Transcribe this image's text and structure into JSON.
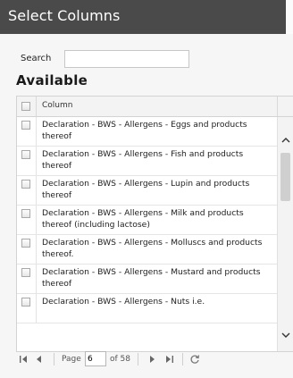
{
  "dialog": {
    "title": "Select Columns"
  },
  "search": {
    "label": "Search",
    "value": "",
    "placeholder": ""
  },
  "available": {
    "title": "Available",
    "column_header": "Column",
    "rows": [
      {
        "label": "Declaration - BWS - Allergens - Eggs and products thereof",
        "checked": false
      },
      {
        "label": "Declaration - BWS - Allergens - Fish and products thereof",
        "checked": false
      },
      {
        "label": "Declaration - BWS - Allergens - Lupin and products thereof",
        "checked": false
      },
      {
        "label": "Declaration - BWS - Allergens - Milk and products thereof (including lactose)",
        "checked": false
      },
      {
        "label": "Declaration - BWS - Allergens - Molluscs and products thereof.",
        "checked": false
      },
      {
        "label": "Declaration - BWS - Allergens - Mustard and products thereof",
        "checked": false
      },
      {
        "label": "Declaration - BWS - Allergens - Nuts i.e.",
        "checked": false
      }
    ]
  },
  "scrollbar": {
    "up_icon": "chevron-up-icon",
    "down_icon": "chevron-down-icon",
    "position_fraction": 0.1
  },
  "pager": {
    "page_label": "Page",
    "current_page": "6",
    "of_label": "of 58",
    "icons": {
      "first": "first-page-icon",
      "prev": "prev-page-icon",
      "next": "next-page-icon",
      "last": "last-page-icon",
      "refresh": "refresh-icon"
    }
  },
  "colors": {
    "titlebar": "#4a4a4a",
    "title_text": "#ffffff",
    "panel": "#f6f6f6",
    "border": "#d3d3d3"
  }
}
